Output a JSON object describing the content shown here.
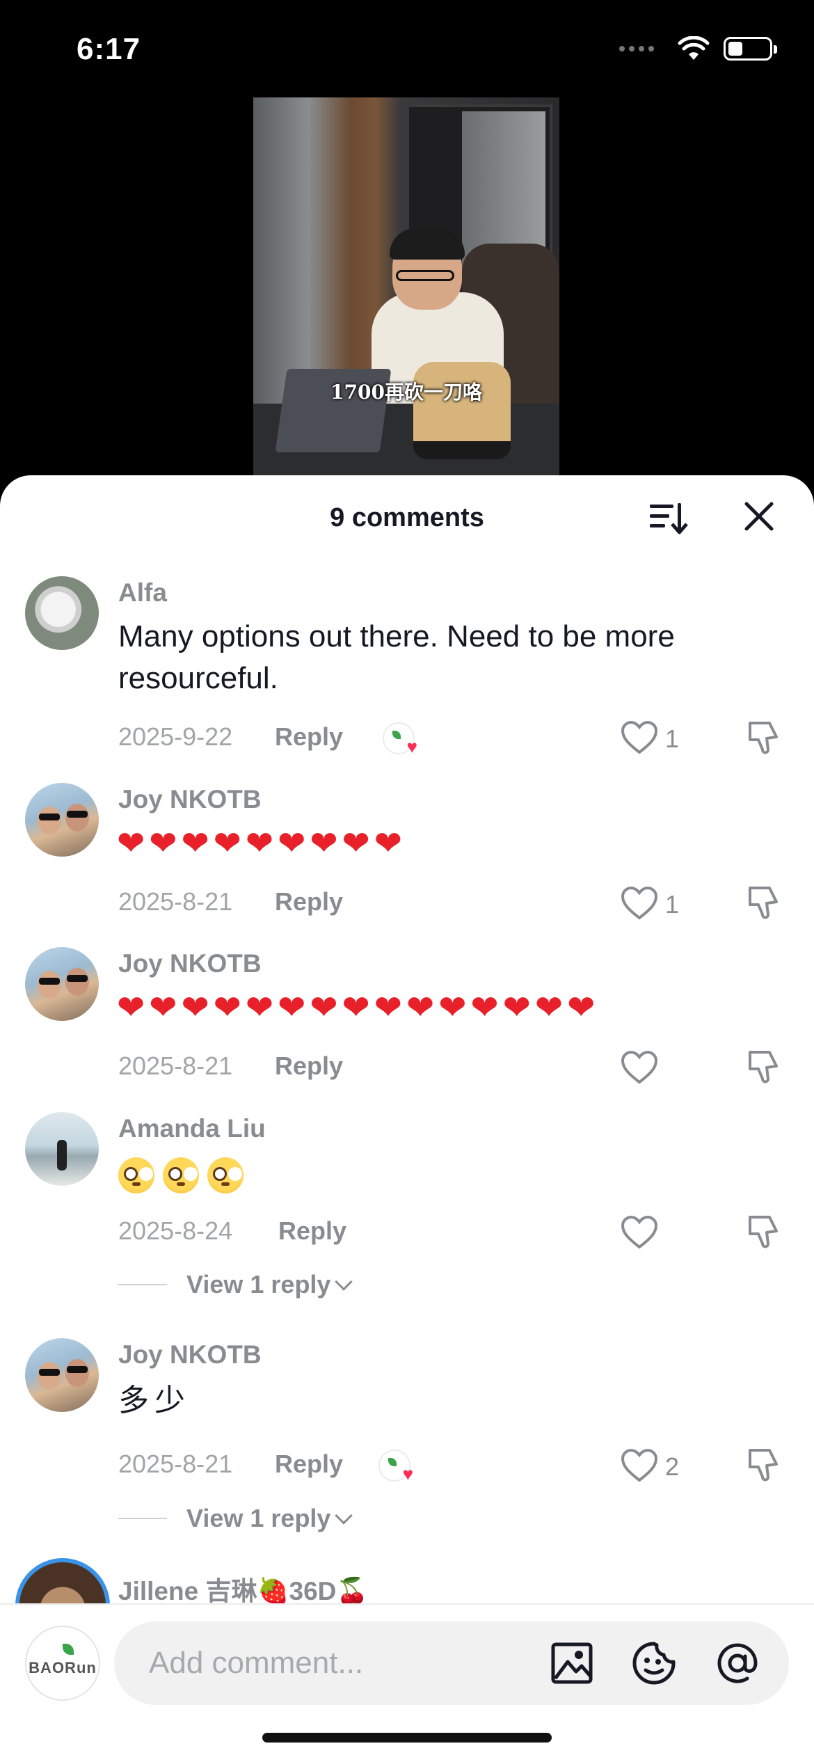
{
  "status_bar": {
    "time": "6:17"
  },
  "video": {
    "caption": "1700再砍一刀咯"
  },
  "sheet": {
    "title": "9 comments"
  },
  "comments": [
    {
      "username": "Alfa",
      "text": "Many options out there. Need to be more resourceful.",
      "date": "2025-9-22",
      "reply": "Reply",
      "likes": "1",
      "creator_liked": true
    },
    {
      "username": "Joy NKOTB",
      "text": "❤❤❤❤❤❤❤❤❤",
      "date": "2025-8-21",
      "reply": "Reply",
      "likes": "1"
    },
    {
      "username": "Joy NKOTB",
      "text": "❤❤❤❤❤❤❤❤❤❤❤❤❤❤❤",
      "date": "2025-8-21",
      "reply": "Reply",
      "likes": ""
    },
    {
      "username": "Amanda Liu",
      "emoji_name": "flushed-face",
      "emoji_count": 3,
      "date": "2025-8-24",
      "reply": "Reply",
      "likes": "",
      "view_replies": "View 1 reply"
    },
    {
      "username": "Joy NKOTB",
      "text": "多少",
      "date": "2025-8-21",
      "reply": "Reply",
      "likes": "2",
      "creator_liked": true,
      "view_replies": "View 1 reply"
    },
    {
      "username": "Jillene 吉琳🍓36D🍒"
    }
  ],
  "input": {
    "placeholder": "Add comment...",
    "brand_avatar_text": "BAORun"
  },
  "colors": {
    "accent_heart": "#fe2c55",
    "emoji_heart": "#e8202a",
    "story_ring": "#3b93e8"
  }
}
